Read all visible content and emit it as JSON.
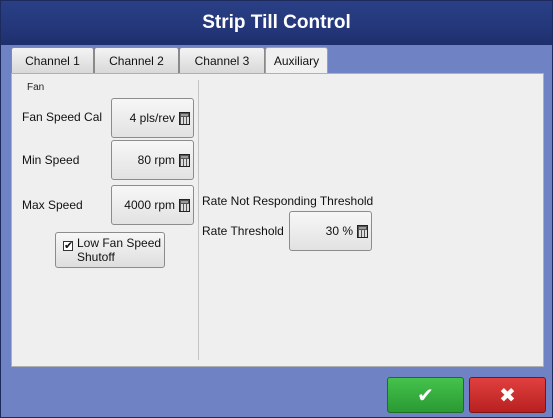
{
  "window": {
    "title": "Strip Till Control"
  },
  "tabs": [
    {
      "label": "Channel 1",
      "active": false
    },
    {
      "label": "Channel 2",
      "active": false
    },
    {
      "label": "Channel 3",
      "active": false
    },
    {
      "label": "Auxiliary",
      "active": true
    }
  ],
  "fan": {
    "section_label": "Fan",
    "speed_cal": {
      "label": "Fan Speed Cal",
      "value": "4 pls/rev"
    },
    "min_speed": {
      "label": "Min Speed",
      "value": "80 rpm"
    },
    "max_speed": {
      "label": "Max Speed",
      "value": "4000 rpm"
    },
    "shutoff": {
      "label_line1": "Low Fan Speed",
      "label_line2": "Shutoff",
      "checked": true,
      "check_mark": "✔"
    }
  },
  "rate": {
    "section_label": "Rate Not Responding Threshold",
    "threshold": {
      "label": "Rate Threshold",
      "value": "30 %"
    }
  },
  "actions": {
    "ok_glyph": "✔",
    "cancel_glyph": "✖"
  },
  "colors": {
    "ok": "#2fa836",
    "cancel": "#c62827",
    "title_bar": "#24377a",
    "background": "#6f83c4"
  }
}
